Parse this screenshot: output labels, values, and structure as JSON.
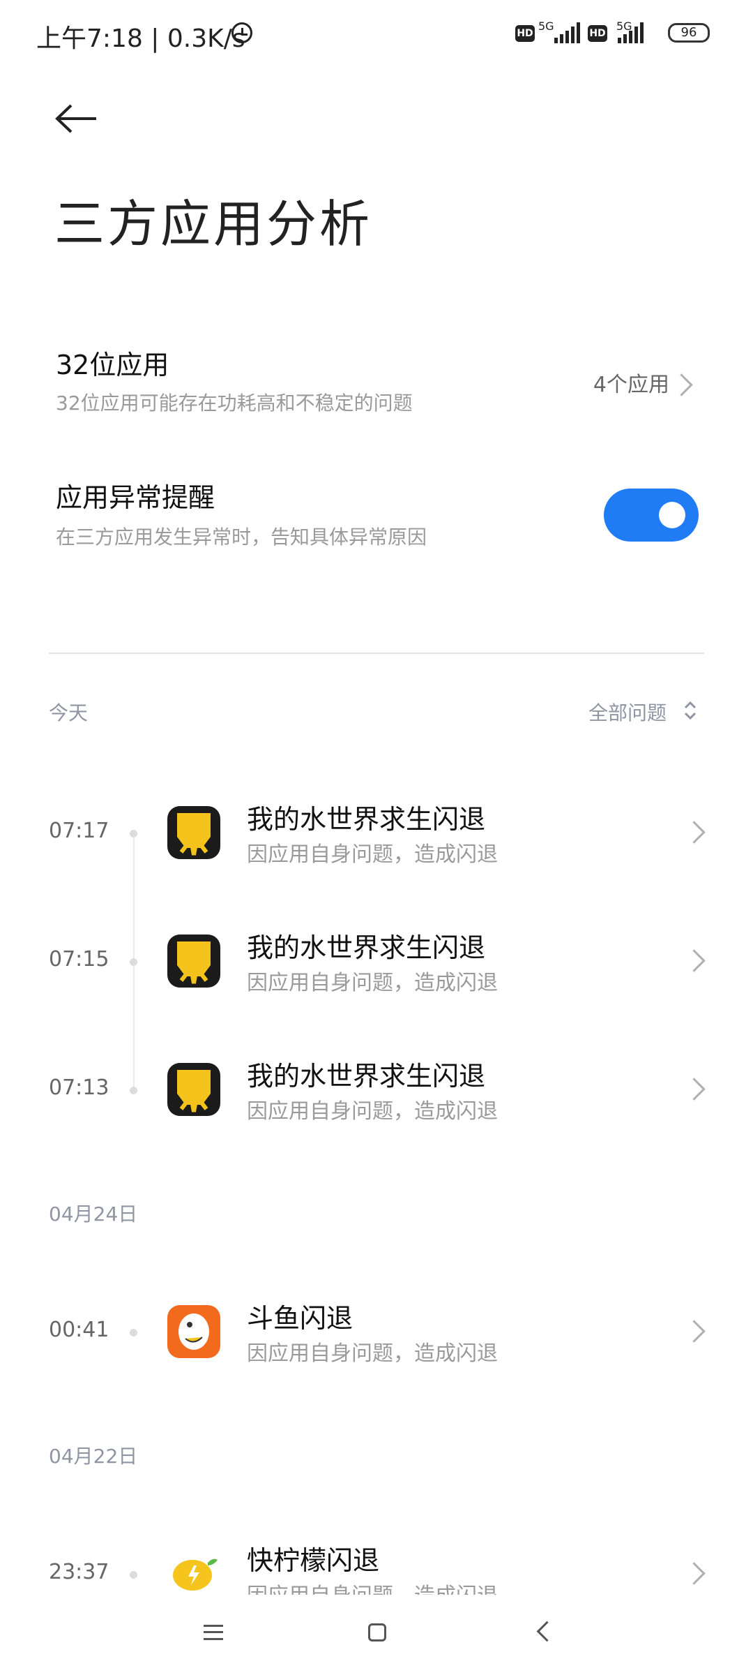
{
  "status_bar": {
    "time_speed": "上午7:18 | 0.3K/s",
    "alarm_icon": "alarm-clock-icon",
    "sim1_hd": "HD",
    "sim1_network": "5G",
    "sim2_hd": "HD",
    "sim2_network": "5G",
    "battery": "96"
  },
  "header": {
    "back_icon": "back-arrow-icon",
    "title": "三方应用分析"
  },
  "settings": {
    "apps32": {
      "title": "32位应用",
      "subtitle": "32位应用可能存在功耗高和不稳定的问题",
      "value": "4个应用"
    },
    "anomaly_alert": {
      "title": "应用异常提醒",
      "subtitle": "在三方应用发生异常时，告知具体异常原因",
      "enabled": true
    }
  },
  "list": {
    "filter_label": "全部问题",
    "sections": [
      {
        "label": "今天",
        "items": [
          {
            "time": "07:17",
            "name": "我的水世界求生闪退",
            "reason": "因应用自身问题，造成闪退"
          },
          {
            "time": "07:15",
            "name": "我的水世界求生闪退",
            "reason": "因应用自身问题，造成闪退"
          },
          {
            "time": "07:13",
            "name": "我的水世界求生闪退",
            "reason": "因应用自身问题，造成闪退"
          }
        ]
      },
      {
        "label": "04月24日",
        "items": [
          {
            "time": "00:41",
            "name": "斗鱼闪退",
            "reason": "因应用自身问题，造成闪退"
          }
        ]
      },
      {
        "label": "04月22日",
        "items": [
          {
            "time": "23:37",
            "name": "快柠檬闪退",
            "reason": "因应用自身问题，造成闪退"
          }
        ]
      }
    ]
  },
  "navbar": {
    "menu_icon": "menu-icon",
    "home_icon": "home-icon",
    "back_icon": "back-icon"
  },
  "colors": {
    "accent": "#1f7cf5",
    "secondary_text": "#9a9a9a"
  }
}
